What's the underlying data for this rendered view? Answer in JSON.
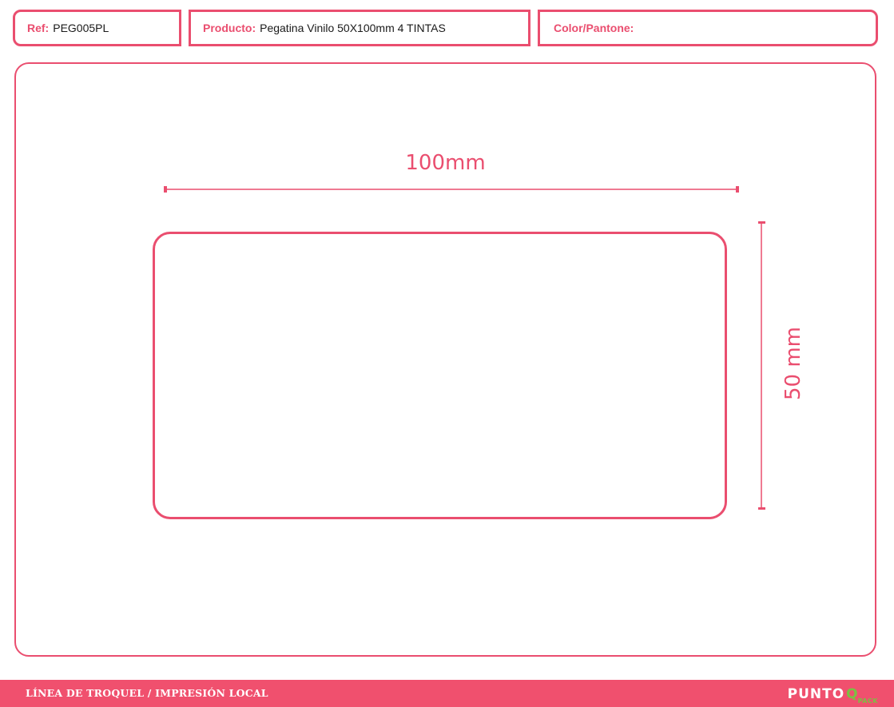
{
  "header": {
    "ref": {
      "label": "Ref:",
      "value": "PEG005PL"
    },
    "product": {
      "label": "Producto:",
      "value": "Pegatina Vinilo 50X100mm 4 TINTAS"
    },
    "color": {
      "label": "Color/Pantone:",
      "value": ""
    }
  },
  "drawing": {
    "width_label": "100mm",
    "height_label": "50 mm"
  },
  "footer": {
    "text": "LÍNEA DE TROQUEL / IMPRESIÓN LOCAL",
    "brand": "PUNTO",
    "brand_q": "Q",
    "brand_pack": "PACK"
  },
  "colors": {
    "accent": "#ea4e6f",
    "footer_bg": "#f0506e",
    "brand_green": "#7bc043"
  }
}
